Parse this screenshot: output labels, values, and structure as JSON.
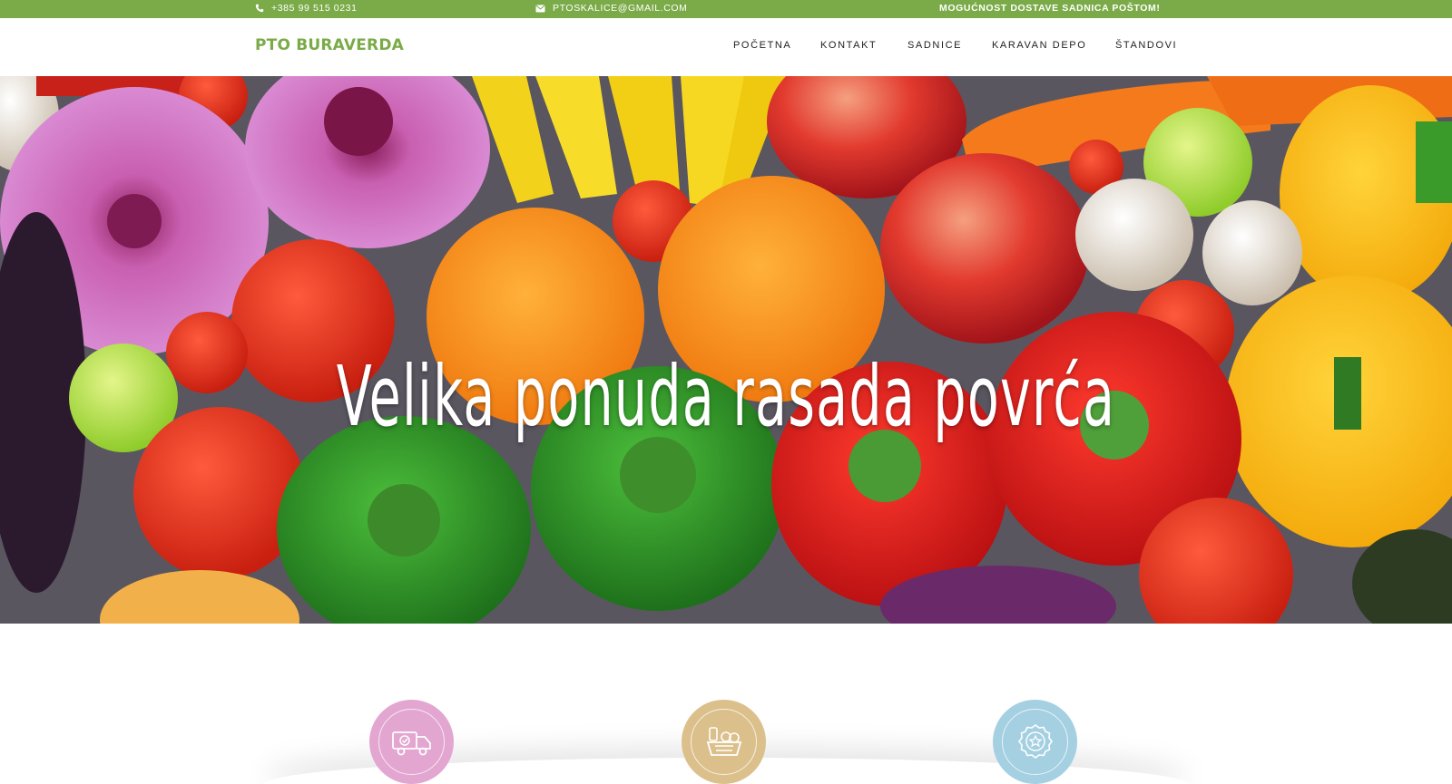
{
  "topbar": {
    "phone": "+385 99 515 0231",
    "email": "PTOSKALICE@GMAIL.COM",
    "note": "MOGUĆNOST DOSTAVE SADNICA POŠTOM!",
    "bg_color": "#7bab48"
  },
  "header": {
    "logo": "PTO BURAVERDA",
    "nav": [
      "POČETNA",
      "KONTAKT",
      "SADNICE",
      "KARAVAN DEPO",
      "ŠTANDOVI"
    ]
  },
  "hero": {
    "title": "Velika ponuda rasada povrća"
  },
  "features": [
    {
      "icon": "delivery-truck-icon",
      "color": "#e2a6d1"
    },
    {
      "icon": "vegetable-basket-icon",
      "color": "#dcc08c"
    },
    {
      "icon": "quality-badge-icon",
      "color": "#a4d0e2"
    }
  ]
}
